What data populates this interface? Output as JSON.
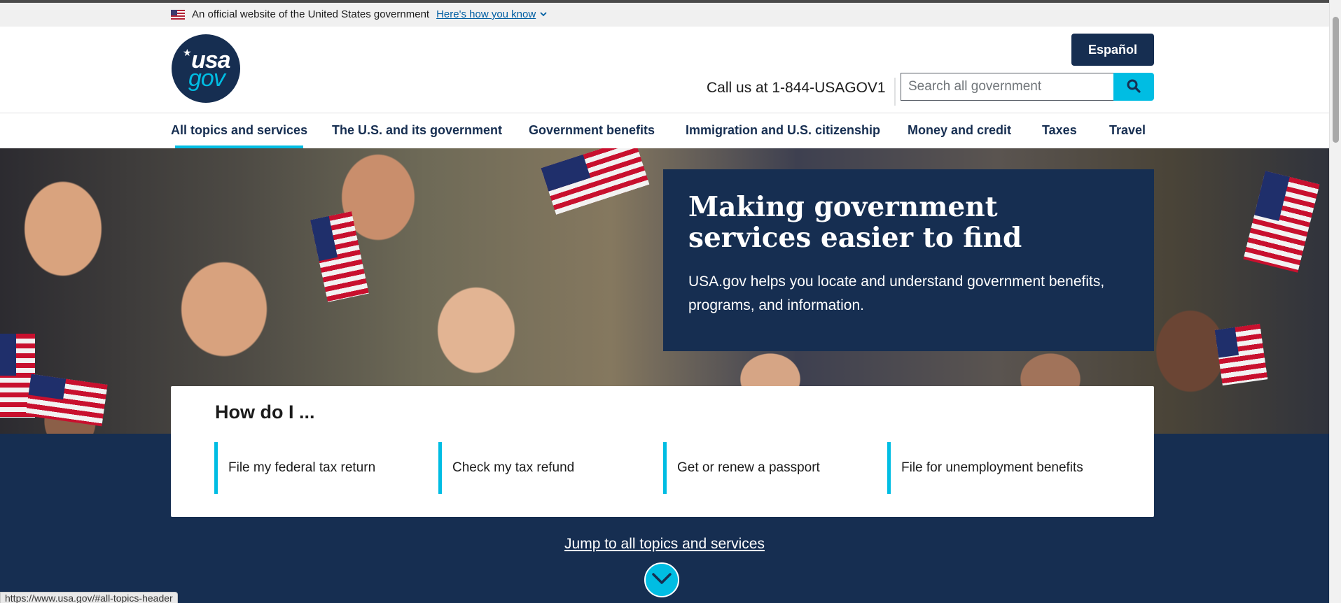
{
  "gov_banner": {
    "official_text": "An official website of the United States government",
    "how_you_know": "Here's how you know"
  },
  "header": {
    "logo_text_top": "usa",
    "logo_text_bottom": "gov",
    "espanol_label": "Español",
    "call_us": "Call us at 1-844-USAGOV1",
    "search_placeholder": "Search all government"
  },
  "nav": {
    "items": [
      {
        "label": "All topics and services",
        "active": true
      },
      {
        "label": "The U.S. and its government",
        "active": false
      },
      {
        "label": "Government benefits",
        "active": false
      },
      {
        "label": "Immigration and U.S. citizenship",
        "active": false
      },
      {
        "label": "Money and credit",
        "active": false
      },
      {
        "label": "Taxes",
        "active": false
      },
      {
        "label": "Travel",
        "active": false
      }
    ]
  },
  "hero": {
    "title": "Making government services easier to find",
    "description": "USA.gov helps you locate and understand government benefits, programs, and information."
  },
  "how_do_i": {
    "heading": "How do I ...",
    "links": [
      "File my federal tax return",
      "Check my tax refund",
      "Get or renew a passport",
      "File for unemployment benefits"
    ]
  },
  "jump_link": "Jump to all topics and services",
  "status_url": "https://www.usa.gov/#all-topics-header",
  "colors": {
    "navy": "#162e51",
    "cyan": "#00bde3",
    "link_blue": "#005ea2"
  },
  "icons": {
    "search": "search-icon",
    "chevron_down": "chevron-down-icon",
    "flag": "us-flag-icon"
  }
}
